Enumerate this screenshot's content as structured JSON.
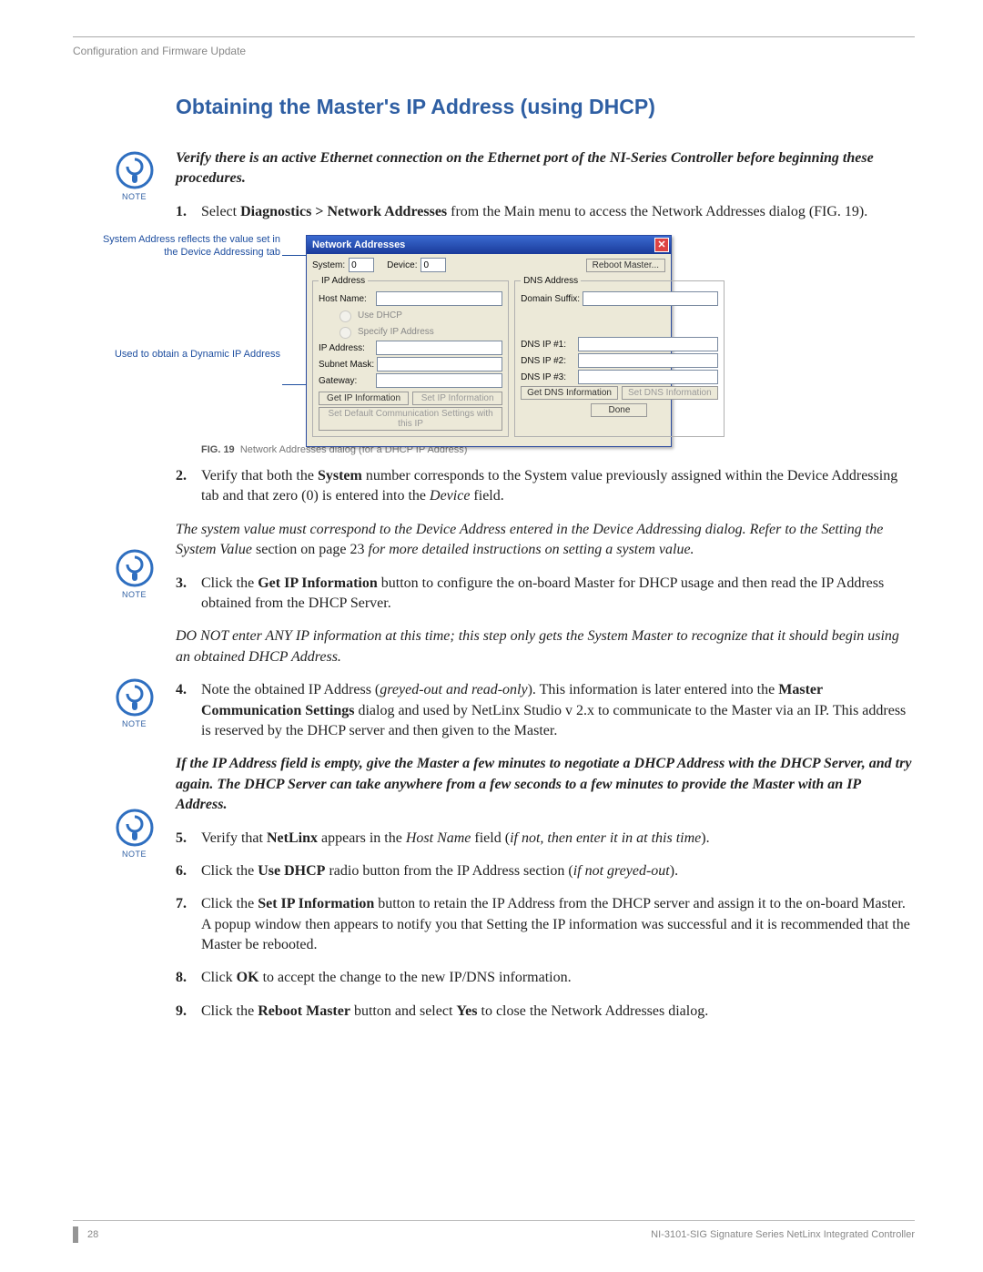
{
  "header": {
    "breadcrumb": "Configuration and Firmware Update"
  },
  "title": "Obtaining the Master's IP Address (using DHCP)",
  "note1": "Verify there is an active Ethernet connection on the Ethernet port of the NI-Series Controller before beginning these procedures.",
  "note2_a": "The system value must correspond to the Device Address entered in the Device Addressing dialog. Refer to the Setting the System Value ",
  "note2_b": "section on page 23 ",
  "note2_c": "for more detailed instructions on setting a system value.",
  "note3": "DO NOT enter ANY IP information at this time; this step only gets the System Master to recognize that it should begin using an obtained DHCP Address.",
  "note4": "If the IP Address field is empty, give the Master a few minutes to negotiate a DHCP Address with the DHCP Server, and try again. The DHCP Server can take anywhere from a few seconds to a few minutes to provide the Master with an IP Address.",
  "steps": {
    "s1a": "Select ",
    "s1b": "Diagnostics > Network Addresses",
    "s1c": " from the Main menu to access the Network Addresses dialog (FIG. 19).",
    "s2a": "Verify that both the ",
    "s2b": "System",
    "s2c": " number corresponds to the System value previously assigned within the Device Addressing tab and that zero (0) is entered into the ",
    "s2d": "Device",
    "s2e": " field.",
    "s3a": "Click the ",
    "s3b": "Get IP Information",
    "s3c": " button to configure the on-board Master for DHCP usage and then read the IP Address obtained from the DHCP Server.",
    "s4a": "Note the obtained IP Address (",
    "s4b": "greyed-out and read-only",
    "s4c": "). This information is later entered into the ",
    "s4d": "Master Communication Settings",
    "s4e": " dialog and used by NetLinx Studio v 2.x to communicate to the Master via an IP. This address is reserved by the DHCP server and then given to the Master.",
    "s5a": "Verify that ",
    "s5b": "NetLinx",
    "s5c": " appears in the ",
    "s5d": "Host Name",
    "s5e": " field (",
    "s5f": "if not, then enter it in at this time",
    "s5g": ").",
    "s6a": "Click the ",
    "s6b": "Use DHCP",
    "s6c": " radio button from the IP Address section (",
    "s6d": "if not greyed-out",
    "s6e": ").",
    "s7a": "Click the ",
    "s7b": "Set IP Information",
    "s7c": " button to retain the IP Address from the DHCP server and assign it to the on-board Master. A popup window then appears to notify you that Setting the IP information was successful and it is recommended that the Master be rebooted.",
    "s8a": "Click ",
    "s8b": "OK",
    "s8c": " to accept the change to the new IP/DNS information.",
    "s9a": "Click the ",
    "s9b": "Reboot Master",
    "s9c": " button and select ",
    "s9d": "Yes",
    "s9e": " to close the Network Addresses dialog."
  },
  "callouts": {
    "c1": "System Address reflects the value set in the Device Addressing tab",
    "c2": "Used to obtain a Dynamic IP Address"
  },
  "fig": {
    "no": "FIG. 19",
    "caption": "Network Addresses dialog (for a DHCP IP Address)"
  },
  "dialog": {
    "title": "Network Addresses",
    "system_lbl": "System:",
    "system_val": "0",
    "device_lbl": "Device:",
    "device_val": "0",
    "reboot": "Reboot Master...",
    "ip_group": "IP Address",
    "dns_group": "DNS Address",
    "hostname": "Host Name:",
    "use_dhcp": "Use DHCP",
    "spec_ip": "Specify IP Address",
    "ipaddr": "IP Address:",
    "subnet": "Subnet Mask:",
    "gateway": "Gateway:",
    "domain": "Domain Suffix:",
    "dns1": "DNS IP #1:",
    "dns2": "DNS IP #2:",
    "dns3": "DNS IP #3:",
    "get_ip": "Get IP Information",
    "set_ip": "Set IP Information",
    "get_dns": "Get DNS Information",
    "set_dns": "Set DNS Information",
    "set_default": "Set Default Communication Settings with this IP",
    "done": "Done"
  },
  "note_label": "NOTE",
  "footer": {
    "page": "28",
    "book": "NI-3101-SIG Signature Series NetLinx Integrated Controller"
  }
}
